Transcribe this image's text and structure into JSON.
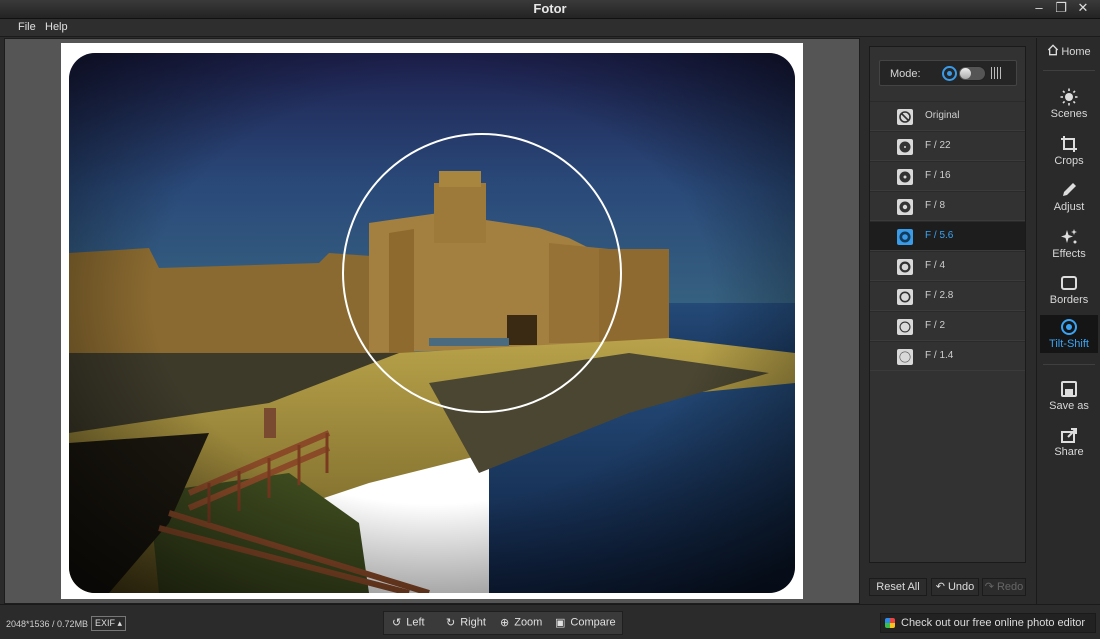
{
  "window": {
    "title": "Fotor"
  },
  "menu": {
    "items": [
      "File",
      "Help"
    ]
  },
  "panel": {
    "mode_label": "Mode:",
    "apertures": [
      {
        "label": "Original",
        "icon": "no-blur-icon",
        "selected": false
      },
      {
        "label": "F / 22",
        "icon": "aperture-icon",
        "selected": false
      },
      {
        "label": "F / 16",
        "icon": "aperture-icon",
        "selected": false
      },
      {
        "label": "F / 8",
        "icon": "aperture-icon",
        "selected": false
      },
      {
        "label": "F / 5.6",
        "icon": "aperture-icon",
        "selected": true
      },
      {
        "label": "F / 4",
        "icon": "aperture-icon",
        "selected": false
      },
      {
        "label": "F / 2.8",
        "icon": "aperture-icon",
        "selected": false
      },
      {
        "label": "F / 2",
        "icon": "aperture-icon",
        "selected": false
      },
      {
        "label": "F / 1.4",
        "icon": "aperture-icon",
        "selected": false
      }
    ],
    "reset_label": "Reset All",
    "undo_label": "Undo",
    "redo_label": "Redo"
  },
  "nav": {
    "home": "Home",
    "scenes": "Scenes",
    "crops": "Crops",
    "adjust": "Adjust",
    "effects": "Effects",
    "borders": "Borders",
    "tiltshift": "Tilt-Shift",
    "saveas": "Save as",
    "share": "Share",
    "active": "Tilt-Shift"
  },
  "status": {
    "image_info": "2048*1536 / 0.72MB",
    "exif_label": "EXIF ▴",
    "tools": {
      "left": "Left",
      "right": "Right",
      "zoom": "Zoom",
      "compare": "Compare"
    },
    "promo": "Check out our free online photo editor"
  },
  "colors": {
    "accent": "#3aa4f4",
    "panel": "#323232",
    "background": "#2b2b2b"
  }
}
